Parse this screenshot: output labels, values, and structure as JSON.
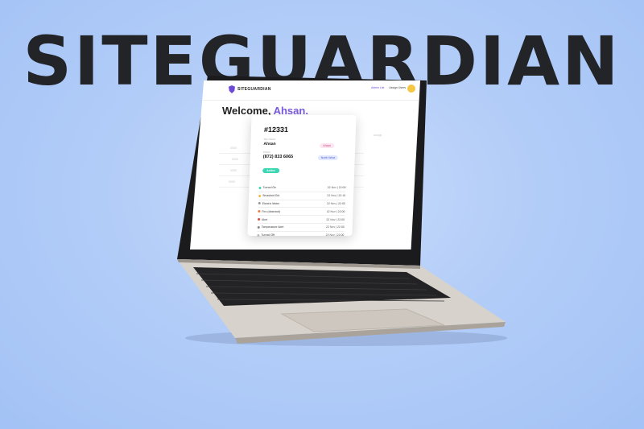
{
  "hero": {
    "title": "SITEGUARDIAN"
  },
  "app": {
    "logo_text": "SITEGUARDIAN",
    "nav_link": "Admin List",
    "account_link": "Assign Users",
    "welcome_prefix": "Welcome,",
    "welcome_name": "Ahsan.",
    "ghost_labels": [
      "0000",
      "0000",
      "0000",
      "0000"
    ],
    "filter_label": "Assign"
  },
  "card": {
    "site_id": "#12331",
    "owner_label": "Site Owner",
    "owner": "Ahsan",
    "phone_label": "Phone",
    "phone": "(872) 833 6065",
    "owner_pill": "Ahsan",
    "location_pill": "North West",
    "status": "Active",
    "events": [
      {
        "name": "Turned On",
        "time": "22 Nov | 22:00",
        "color": "#3dd6b4"
      },
      {
        "name": "Smashed Glo",
        "time": "22 Nov | 22:10",
        "color": "#f5b942"
      },
      {
        "name": "Electric Meter",
        "time": "22 Nov | 22:00",
        "color": "#999999"
      },
      {
        "name": "Fire (detected)",
        "time": "22 Nov | 22:00",
        "color": "#f07a3a"
      },
      {
        "name": "Alert",
        "time": "22 Nov | 22:00",
        "color": "#e0453a"
      },
      {
        "name": "Temperature Alert",
        "time": "22 Nov | 22:00",
        "color": "#888888"
      },
      {
        "name": "Turned Off",
        "time": "22 Nov | 22:00",
        "color": "#bbbbbb"
      }
    ]
  },
  "colors": {
    "accent": "#7b5cde",
    "background": "#b3cdf8",
    "status": "#3dd6b4"
  }
}
